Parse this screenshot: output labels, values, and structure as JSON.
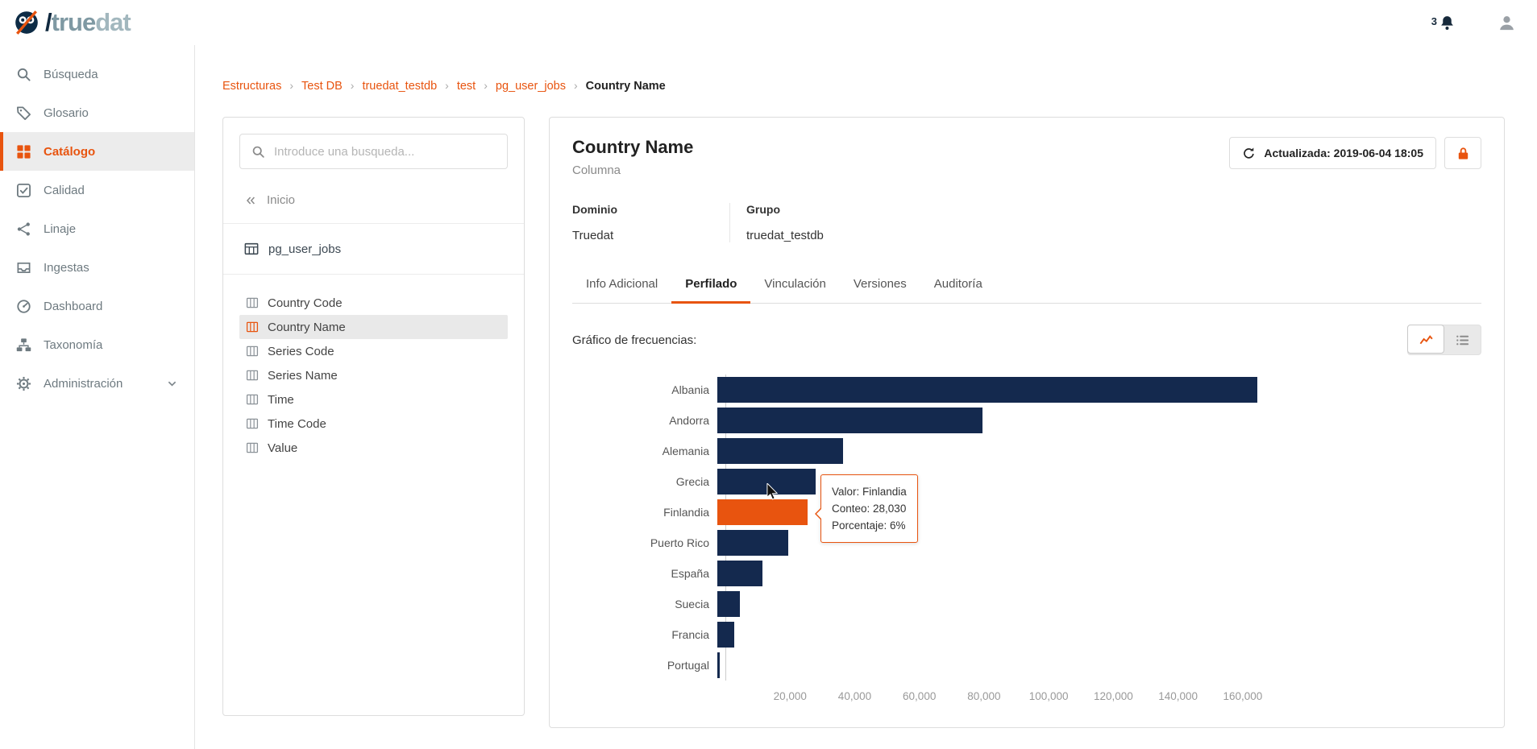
{
  "colors": {
    "accent": "#e8540f",
    "bar_navy": "#14294e",
    "breadcrumb_link": "#e8540f",
    "logo_navy": "#10293f",
    "logo_teal": "#7f99a3"
  },
  "header": {
    "logo": {
      "slash": "/",
      "part1": "true",
      "part2": "dat"
    },
    "notification_count": "3"
  },
  "sidebar": {
    "items": [
      {
        "label": "Búsqueda",
        "icon": "search-icon",
        "active": false
      },
      {
        "label": "Glosario",
        "icon": "tag-icon",
        "active": false
      },
      {
        "label": "Catálogo",
        "icon": "grid-icon",
        "active": true
      },
      {
        "label": "Calidad",
        "icon": "check-square-icon",
        "active": false
      },
      {
        "label": "Linaje",
        "icon": "share-icon",
        "active": false
      },
      {
        "label": "Ingestas",
        "icon": "inbox-icon",
        "active": false
      },
      {
        "label": "Dashboard",
        "icon": "gauge-icon",
        "active": false
      },
      {
        "label": "Taxonomía",
        "icon": "sitemap-icon",
        "active": false
      },
      {
        "label": "Administración",
        "icon": "gear-icon",
        "active": false,
        "has_chevron": true
      }
    ]
  },
  "breadcrumb": {
    "items": [
      "Estructuras",
      "Test DB",
      "truedat_testdb",
      "test",
      "pg_user_jobs"
    ],
    "current": "Country Name"
  },
  "explorer": {
    "search_placeholder": "Introduce una busqueda...",
    "back_label": "Inicio",
    "table_name": "pg_user_jobs",
    "columns": [
      "Country Code",
      "Country Name",
      "Series Code",
      "Series Name",
      "Time",
      "Time Code",
      "Value"
    ],
    "selected_column": "Country Name"
  },
  "detail": {
    "title": "Country Name",
    "subtitle": "Columna",
    "updated_label": "Actualizada: 2019-06-04 18:05",
    "fields": [
      {
        "label": "Dominio",
        "value": "Truedat"
      },
      {
        "label": "Grupo",
        "value": "truedat_testdb"
      }
    ],
    "tabs": [
      "Info Adicional",
      "Perfilado",
      "Vinculación",
      "Versiones",
      "Auditoría"
    ],
    "active_tab": "Perfilado",
    "section_label": "Gráfico de frecuencias:"
  },
  "tooltip": {
    "lines": [
      "Valor: Finlandia",
      "Conteo: 28,030",
      "Porcentaje: 6%"
    ]
  },
  "chart_data": {
    "type": "bar",
    "orientation": "horizontal",
    "title": "Gráfico de frecuencias",
    "categories": [
      "Albania",
      "Andorra",
      "Alemania",
      "Grecia",
      "Finlandia",
      "Puerto Rico",
      "España",
      "Suecia",
      "Francia",
      "Portugal"
    ],
    "values": [
      167000,
      82000,
      39000,
      30500,
      28030,
      22000,
      14000,
      7000,
      5200,
      800
    ],
    "highlighted": "Finlandia",
    "highlight_tooltip": {
      "valor": "Finlandia",
      "conteo": "28,030",
      "porcentaje": "6%"
    },
    "xticks": [
      20000,
      40000,
      60000,
      80000,
      100000,
      120000,
      140000,
      160000
    ],
    "xtick_labels": [
      "20,000",
      "40,000",
      "60,000",
      "80,000",
      "100,000",
      "120,000",
      "140,000",
      "160,000"
    ],
    "xlim": [
      0,
      172000
    ],
    "grid": false,
    "legend": false
  }
}
